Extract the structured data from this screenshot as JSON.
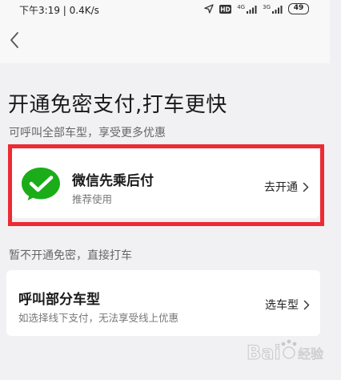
{
  "status_bar": {
    "time": "下午3:19 | 0.4K/s",
    "hd_badge": "HD",
    "signal_1_tag": "4G",
    "signal_2_tag": "3G",
    "battery": "49",
    "icons": [
      "location-arrow-icon",
      "hd-icon",
      "signal-icon",
      "signal-icon",
      "battery-icon"
    ]
  },
  "header": {
    "back_icon": "chevron-left-icon"
  },
  "main": {
    "title": "开通免密支付,打车更快",
    "subtitle": "可呼叫全部车型，享受更多优惠",
    "wechat_option": {
      "title": "微信先乘后付",
      "desc": "推荐使用",
      "action": "去开通",
      "icon": "wechat-pay-icon",
      "accent": "#1aad19",
      "highlight_color": "#ec2b33"
    },
    "skip_label": "暂不开通免密，直接打车",
    "model_option": {
      "title": "呼叫部分车型",
      "desc": "如选择线下支付，无法享受线上优惠",
      "action": "选车型"
    }
  },
  "watermark": {
    "brand": "Bai",
    "brand_suffix": "经验"
  }
}
